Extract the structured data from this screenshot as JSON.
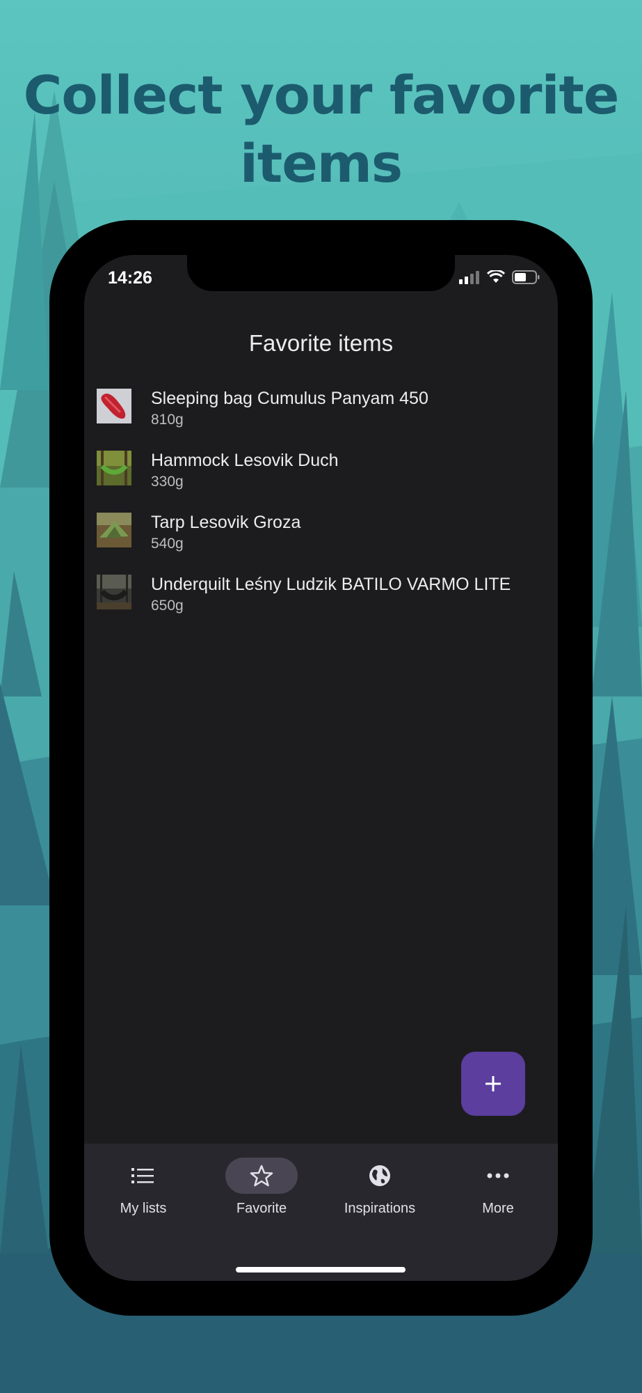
{
  "headline": {
    "line1": "Collect your favorite",
    "line2": "items"
  },
  "status_bar": {
    "time": "14:26",
    "icons": [
      "signal-icon",
      "wifi-icon",
      "battery-icon"
    ]
  },
  "screen": {
    "title": "Favorite items"
  },
  "items": [
    {
      "name": "Sleeping bag Cumulus Panyam 450",
      "weight": "810g",
      "thumb": "sleeping-bag-thumbnail"
    },
    {
      "name": "Hammock Lesovik Duch",
      "weight": "330g",
      "thumb": "hammock-thumbnail"
    },
    {
      "name": "Tarp Lesovik Groza",
      "weight": "540g",
      "thumb": "tarp-thumbnail"
    },
    {
      "name": "Underquilt Leśny Ludzik BATILO VARMO LITE",
      "weight": "650g",
      "thumb": "underquilt-thumbnail"
    }
  ],
  "fab": {
    "icon": "plus-icon"
  },
  "nav": [
    {
      "label": "My lists",
      "icon": "list-icon",
      "active": false
    },
    {
      "label": "Favorite",
      "icon": "star-icon",
      "active": true
    },
    {
      "label": "Inspirations",
      "icon": "globe-icon",
      "active": false
    },
    {
      "label": "More",
      "icon": "more-dots-icon",
      "active": false
    }
  ],
  "colors": {
    "accent": "#5b3e9e",
    "background_teal": "#5cc5bf",
    "headline": "#1c5b6e",
    "screen_bg": "#1c1c1e",
    "navbar_bg": "#29272e"
  }
}
